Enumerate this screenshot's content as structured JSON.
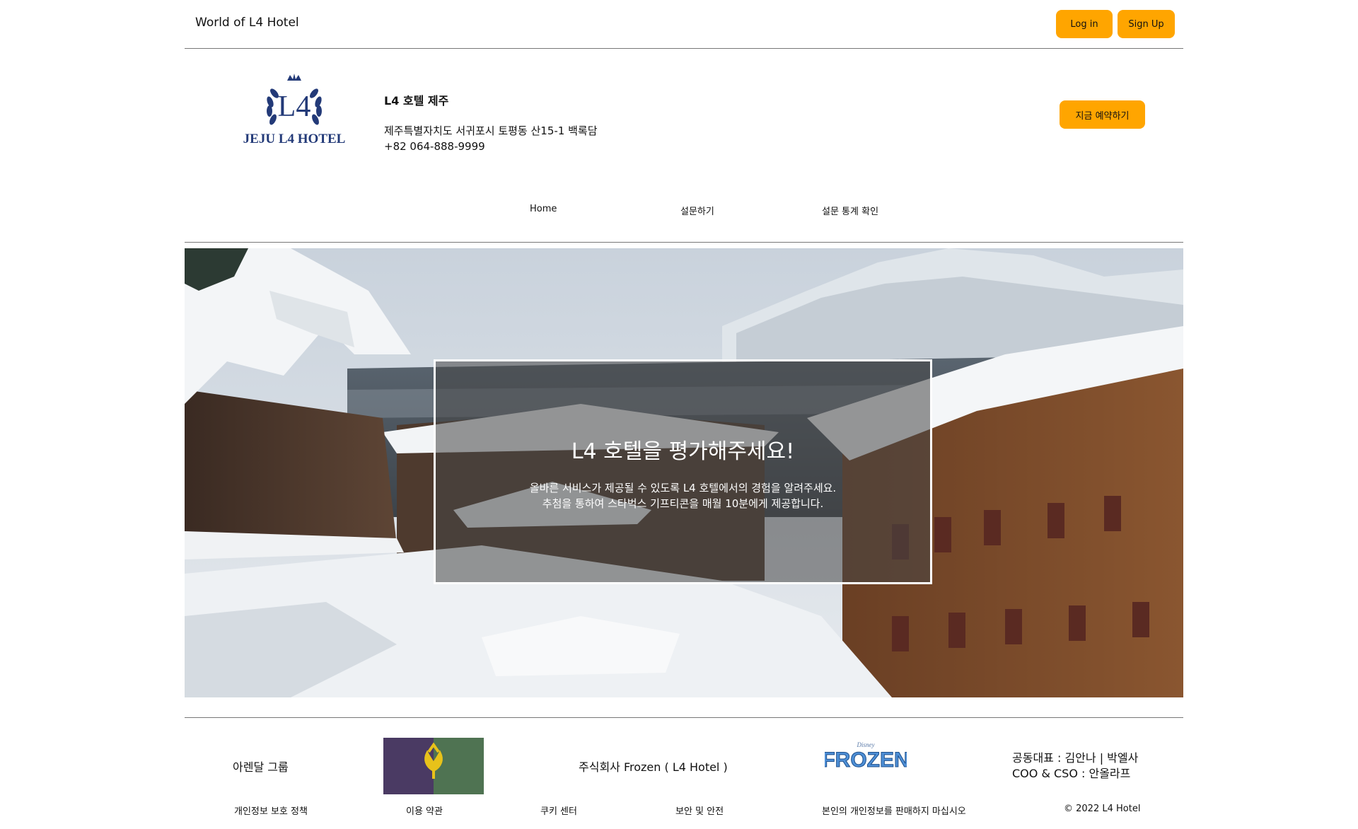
{
  "topbar": {
    "brand": "World of L4 Hotel",
    "login_label": "Log in",
    "signup_label": "Sign Up"
  },
  "header": {
    "logo_letters": "L4",
    "logo_text": "JEJU L4 HOTEL",
    "hotel_name": "L4 호텔 제주",
    "address": "제주특별자치도 서귀포시 토평동 산15-1 백록담",
    "phone": "+82 064-888-9999",
    "book_label": "지금 예약하기"
  },
  "nav": {
    "items": [
      {
        "label": "Home"
      },
      {
        "label": "설문하기"
      },
      {
        "label": "설문 통계 확인"
      }
    ]
  },
  "hero": {
    "title": "L4 호텔을 평가해주세요!",
    "line1": "올바른 서비스가 제공될 수 있도록 L4 호텔에서의 경험을 알려주세요.",
    "line2": "추첨을 통하여 스타벅스 기프티콘을 매월 10분에게 제공합니다."
  },
  "footer": {
    "group": "아렌달 그룹",
    "company": "주식회사 Frozen ( L4 Hotel )",
    "frozen_logo": "FROZEN",
    "frozen_small": "Disney",
    "ceo": "공동대표 : 김안나 | 박엘사",
    "coo": "COO & CSO : 안올라프",
    "links": [
      "개인정보 보호 정책",
      "이용 약관",
      "쿠키 센터",
      "보안 및 안전",
      "본인의 개인정보를 판매하지 마십시오"
    ],
    "copyright": "© 2022 L4 Hotel"
  },
  "colors": {
    "accent": "#ffa500",
    "logo_navy": "#233a78",
    "flag_purple": "#4a3a63",
    "flag_green": "#4f7352",
    "flag_flower": "#e8c21a"
  }
}
